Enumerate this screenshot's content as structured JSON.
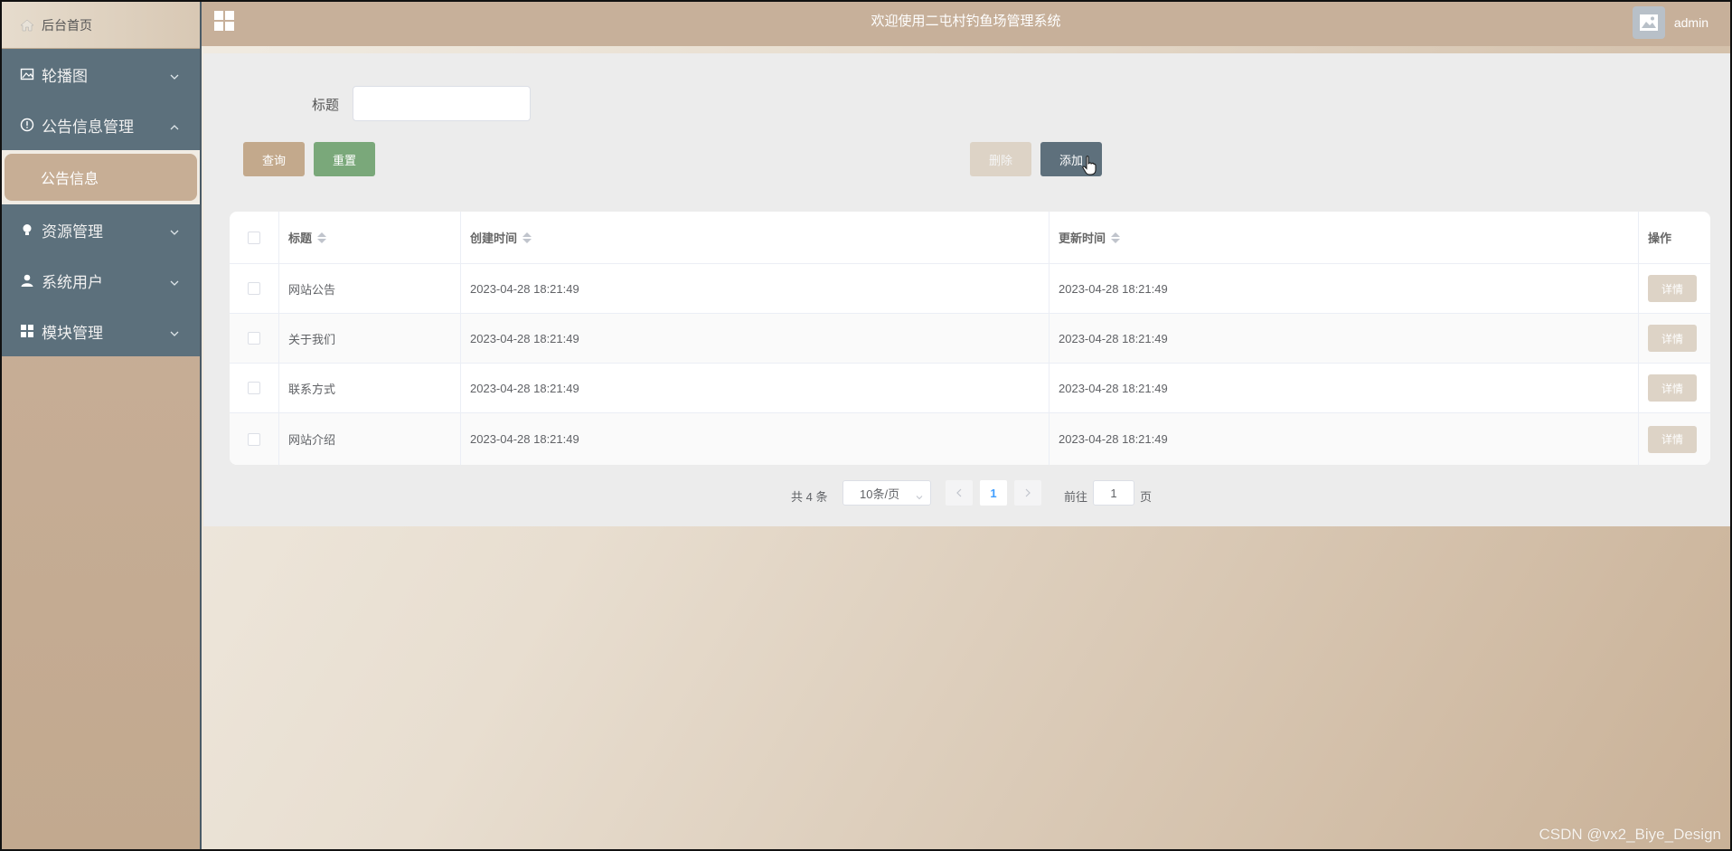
{
  "sidebar": {
    "home_label": "后台首页",
    "items": [
      {
        "label": "轮播图",
        "icon": "image-icon",
        "expanded": false
      },
      {
        "label": "公告信息管理",
        "icon": "info-circle-icon",
        "expanded": true,
        "children": [
          {
            "label": "公告信息",
            "active": true
          }
        ]
      },
      {
        "label": "资源管理",
        "icon": "lightbulb-icon",
        "expanded": false
      },
      {
        "label": "系统用户",
        "icon": "user-icon",
        "expanded": false
      },
      {
        "label": "模块管理",
        "icon": "grid-icon",
        "expanded": false
      }
    ]
  },
  "header": {
    "title": "欢迎使用二屯村钓鱼场管理系统",
    "username": "admin"
  },
  "search": {
    "label": "标题",
    "value": "",
    "placeholder": ""
  },
  "actions": {
    "query": "查询",
    "reset": "重置",
    "delete": "删除",
    "add": "添加"
  },
  "table": {
    "columns": [
      "标题",
      "创建时间",
      "更新时间",
      "操作"
    ],
    "rows": [
      {
        "title": "网站公告",
        "created": "2023-04-28 18:21:49",
        "updated": "2023-04-28 18:21:49",
        "action": "详情"
      },
      {
        "title": "关于我们",
        "created": "2023-04-28 18:21:49",
        "updated": "2023-04-28 18:21:49",
        "action": "详情"
      },
      {
        "title": "联系方式",
        "created": "2023-04-28 18:21:49",
        "updated": "2023-04-28 18:21:49",
        "action": "详情"
      },
      {
        "title": "网站介绍",
        "created": "2023-04-28 18:21:49",
        "updated": "2023-04-28 18:21:49",
        "action": "详情"
      }
    ]
  },
  "pagination": {
    "total": "共 4 条",
    "page_size": "10条/页",
    "current": "1",
    "goto_label": "前往",
    "goto_value": "1",
    "goto_suffix": "页"
  },
  "watermark": "CSDN @vx2_Biye_Design",
  "colors": {
    "sidebar_menu": "#5c707c",
    "header": "#c7b09a",
    "accent_tan": "#c3a98c",
    "accent_green": "#7aa87a",
    "accent_slate": "#5e707c"
  }
}
